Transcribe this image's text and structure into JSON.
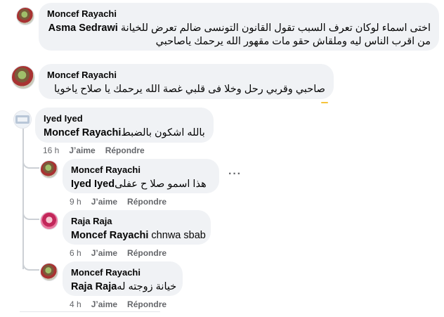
{
  "comments": [
    {
      "author": "Moncef Rayachi",
      "lines": [
        {
          "text": "اختى اسماء لوكان تعرف السبب تقول القانون التونسى ضالم تعرض للخيانة ",
          "mention": "Asma Sedrawi"
        },
        {
          "text": "من اقرب الناس ليه وملقاش حقو مات مقهور الله يرحمك ياصاحبي",
          "mention": ""
        }
      ]
    },
    {
      "author": "Moncef Rayachi",
      "lines": [
        {
          "text": "صاحبي وقربي رحل وخلا فى قلبي غصة الله يرحمك يا صلاح ياخويا",
          "mention": ""
        }
      ]
    },
    {
      "author": "Iyed Iyed",
      "mention": "Moncef Rayachi",
      "text": " بالله اشكون بالضبط",
      "time": "16 h",
      "like": "J’aime",
      "reply": "Répondre"
    }
  ],
  "replies": [
    {
      "author": "Moncef Rayachi",
      "mention": "Iyed Iyed",
      "text": " هذا اسمو صلا ح عفلى",
      "time": "9 h",
      "like": "J’aime",
      "reply": "Répondre",
      "more": "···"
    },
    {
      "author": "Raja Raja",
      "mention": "Moncef Rayachi",
      "text": " chnwa sbab",
      "time": "6 h",
      "like": "J’aime",
      "reply": "Répondre"
    },
    {
      "author": "Moncef Rayachi",
      "mention": "Raja Raja",
      "text": " خيانة زوجته له",
      "time": "4 h",
      "like": "J’aime",
      "reply": "Répondre"
    }
  ]
}
